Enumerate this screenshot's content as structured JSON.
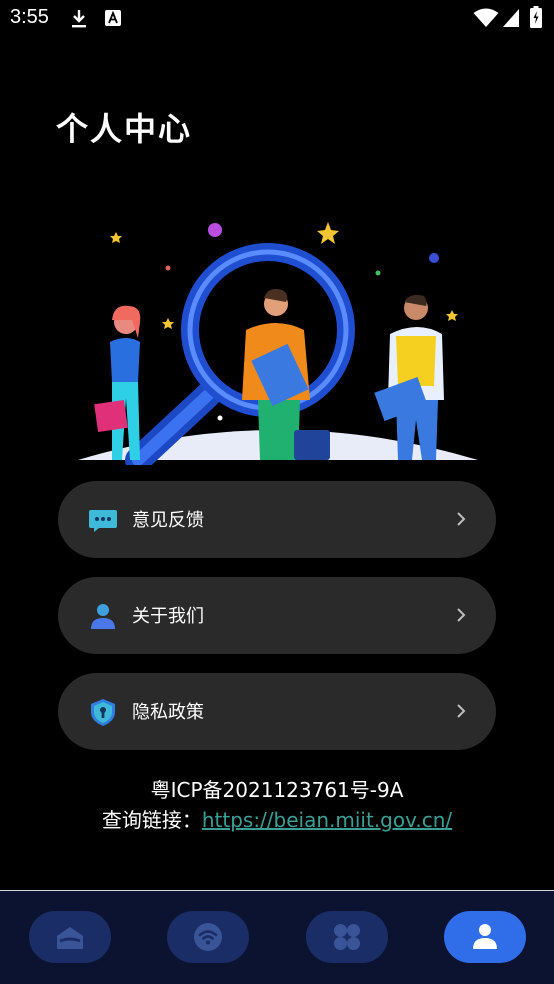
{
  "status_bar": {
    "time": "3:55",
    "icons": [
      "download-icon",
      "text-a-icon",
      "wifi-icon",
      "signal-icon",
      "battery-icon"
    ]
  },
  "page": {
    "title": "个人中心"
  },
  "menu": [
    {
      "label": "意见反馈",
      "icon": "feedback-chat-icon"
    },
    {
      "label": "关于我们",
      "icon": "person-icon"
    },
    {
      "label": "隐私政策",
      "icon": "shield-lock-icon"
    }
  ],
  "footer": {
    "icp": "粤ICP备2021123761号-9A",
    "query_label": "查询链接：",
    "query_url": "https://beian.miit.gov.cn/"
  },
  "bottom_nav": {
    "tabs": [
      {
        "icon": "home-icon",
        "active": false
      },
      {
        "icon": "wifi-icon",
        "active": false
      },
      {
        "icon": "apps-grid-icon",
        "active": false
      },
      {
        "icon": "person-icon",
        "active": true
      }
    ]
  },
  "colors": {
    "background": "#000000",
    "card": "#2a2a2a",
    "link": "#3c9f97",
    "nav_bg": "#0c1330",
    "nav_tab": "#1b2d66",
    "nav_tab_active": "#2f6de9"
  }
}
